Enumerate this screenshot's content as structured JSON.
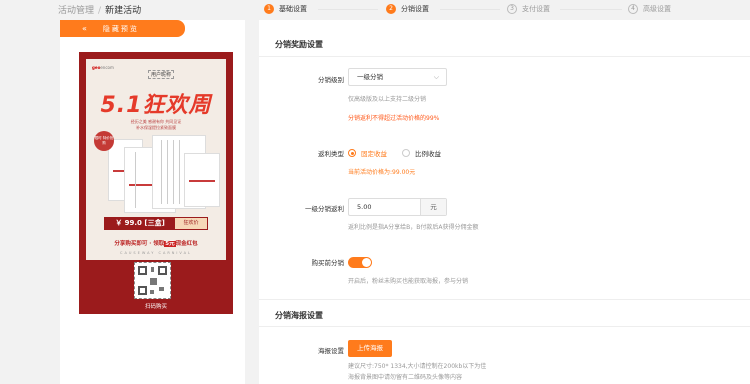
{
  "breadcrumb": {
    "parent": "活动管理",
    "separator": "/",
    "current": "新建活动"
  },
  "steps": [
    {
      "num": "1",
      "label": "基础设置",
      "state": "active"
    },
    {
      "num": "2",
      "label": "分销设置",
      "state": "active"
    },
    {
      "num": "3",
      "label": "支付设置",
      "state": "todo"
    },
    {
      "num": "4",
      "label": "高级设置",
      "state": "todo"
    }
  ],
  "preview": {
    "icon": "chevron-double-left-icon",
    "chevron": "«",
    "label": "隐藏预览"
  },
  "poster": {
    "logo_prefix": "geo",
    "logo_rest": "encom",
    "user_name": "用户昵称",
    "headline": "5.1狂欢周",
    "subtitle_line1": "经历之美 感谢有你 共同见证",
    "subtitle_line2": "补水保湿提拉紧致面膜",
    "badge": "限时 特价抢购",
    "price": "￥ 99.0 [三盒]",
    "price_tag": "狂欢价",
    "share_text_before": "分享购买即可 · 领取",
    "share_highlight": "5元",
    "share_text_after": "现金红包",
    "english_line": "CAUSEWAY CARNIVAL",
    "qr_label": "扫码购买"
  },
  "distribution_reward": {
    "section_title": "分销奖励设置",
    "level": {
      "label": "分销级别",
      "value": "一级分销",
      "hint": "仅高级版及以上支持二级分销",
      "warning": "分销返利不得超过活动价格的99%"
    },
    "rebate_type": {
      "label": "返利类型",
      "options": [
        {
          "label": "固定收益",
          "selected": true
        },
        {
          "label": "比例收益",
          "selected": false
        }
      ],
      "hint": "当前活动价格为:99.00元"
    },
    "first_level_rebate": {
      "label": "一级分销返利",
      "value": "5.00",
      "unit": "元",
      "hint": "返利比例是指A分享给B，B付款后A获得分佣金额"
    },
    "pre_purchase": {
      "label": "购买前分销",
      "enabled": true,
      "hint": "开启后，粉丝未购买也能获取海报，参与分销"
    }
  },
  "distribution_poster": {
    "section_title": "分销海报设置",
    "poster_setting": {
      "label": "海报设置",
      "button": "上传海报",
      "hint1": "建议尺寸:750* 1334,大小请控制在200kb以下为佳",
      "hint2": "海报背景图中请勿留有二维码及头像等内容"
    }
  },
  "colors": {
    "accent": "#ff7b1c",
    "poster_red": "#9b1b1c",
    "warning": "#ff5a1c"
  }
}
